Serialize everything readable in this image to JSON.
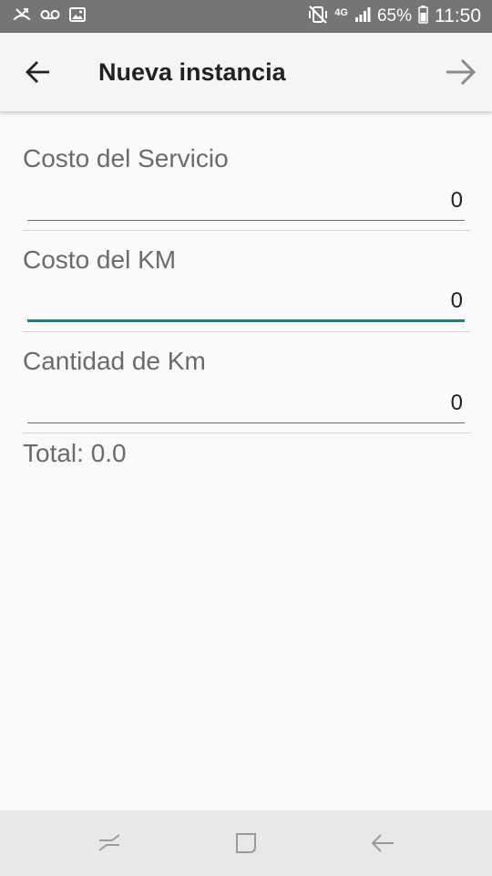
{
  "status_bar": {
    "battery_percent": "65%",
    "time": "11:50",
    "network": "4G",
    "icons": [
      "missed-call-icon",
      "voicemail-icon",
      "image-icon",
      "mute-vibrate-icon",
      "signal-icon",
      "battery-icon"
    ]
  },
  "app_bar": {
    "title": "Nueva instancia",
    "back_icon": "arrow-back-icon",
    "next_icon": "arrow-forward-icon"
  },
  "form": {
    "fields": [
      {
        "label": "Costo del Servicio",
        "value": "0",
        "focused": false
      },
      {
        "label": "Costo del KM",
        "value": "0",
        "focused": true
      },
      {
        "label": "Cantidad de Km",
        "value": "0",
        "focused": false
      }
    ],
    "total": "Total: 0.0"
  },
  "nav_bar": {
    "buttons": [
      "recent-apps-icon",
      "home-icon",
      "back-icon"
    ]
  },
  "colors": {
    "status_bar": "#757575",
    "app_bar": "#f5f5f5",
    "accent": "#1f7f76",
    "background": "#fafafa",
    "nav_bar": "#e8e8e8"
  }
}
